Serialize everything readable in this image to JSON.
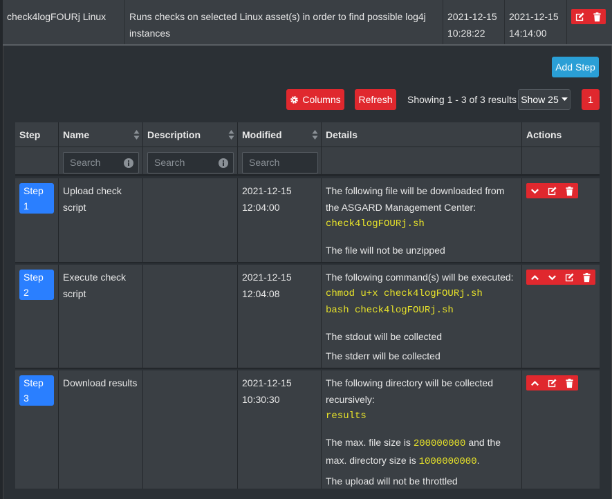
{
  "parent": {
    "name": "check4logFOURj Linux",
    "description": "Runs checks on selected Linux asset(s) in order to find possible log4j instances",
    "created_date": "2021-12-15",
    "created_time": "10:28:22",
    "modified_date": "2021-12-15",
    "modified_time": "14:14:00"
  },
  "toolbar": {
    "add_step": "Add Step",
    "columns": "Columns",
    "refresh": "Refresh",
    "showing": "Showing 1 - 3 of 3 results",
    "show": "Show 25",
    "page": "1"
  },
  "table": {
    "headers": [
      "Step",
      "Name",
      "Description",
      "Modified",
      "Details",
      "Actions"
    ],
    "search_placeholder": "Search",
    "rows": [
      {
        "step": "Step 1",
        "name_line1": "Upload check",
        "name_line2": "script",
        "modified_date": "2021-12-15",
        "modified_time": "12:04:00",
        "d1": "The following file will be downloaded from",
        "d2": "the ASGARD Management Center:",
        "code1": "check4logFOURj.sh",
        "d3": "The file will not be unzipped"
      },
      {
        "step": "Step 2",
        "name_line1": "Execute check",
        "name_line2": "script",
        "modified_date": "2021-12-15",
        "modified_time": "12:04:08",
        "d1": "The following command(s) will be executed:",
        "code1": "chmod u+x check4logFOURj.sh",
        "code2": "bash check4logFOURj.sh",
        "d2": "The stdout will be collected",
        "d3": "The stderr will be collected"
      },
      {
        "step": "Step 3",
        "name_line1": "Download results",
        "modified_date": "2021-12-15",
        "modified_time": "10:30:30",
        "d1": "The following directory will be collected",
        "d2": "recursively:",
        "code1": "results",
        "d3a": "The max. file size is ",
        "code2": "200000000",
        "d3b": " and the",
        "d4a": "max. directory size is ",
        "code3": "1000000000",
        "d4b": ".",
        "d5": "The upload will not be throttled"
      }
    ]
  },
  "colors": {
    "danger": "#e0282e",
    "info": "#2a9fd6",
    "primary": "#2a7fff",
    "code": "#e8e32a"
  }
}
